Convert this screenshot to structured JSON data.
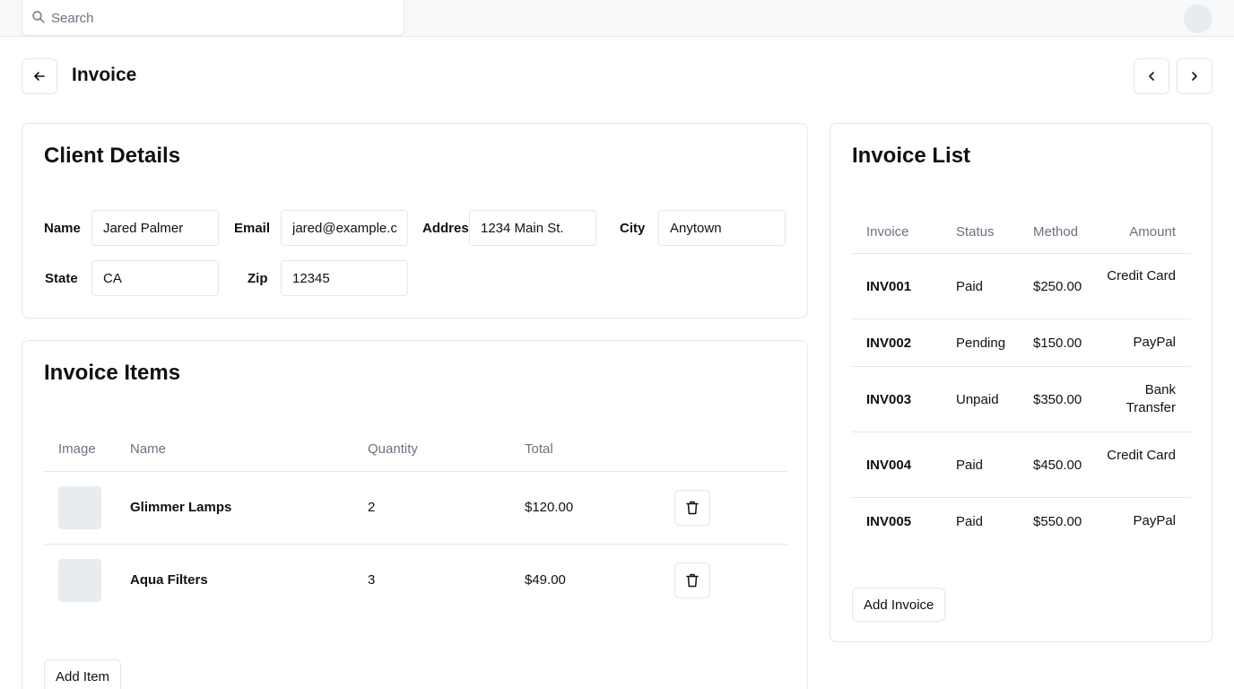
{
  "search": {
    "placeholder": "Search"
  },
  "header": {
    "title": "Invoice"
  },
  "client": {
    "title": "Client Details",
    "fields": {
      "name": {
        "label": "Name",
        "value": "Jared Palmer"
      },
      "email": {
        "label": "Email",
        "value": "jared@example.com"
      },
      "address": {
        "label": "Address",
        "value": "1234 Main St."
      },
      "city": {
        "label": "City",
        "value": "Anytown"
      },
      "state": {
        "label": "State",
        "value": "CA"
      },
      "zip": {
        "label": "Zip",
        "value": "12345"
      }
    }
  },
  "items": {
    "title": "Invoice Items",
    "columns": [
      "Image",
      "Name",
      "Quantity",
      "Total"
    ],
    "rows": [
      {
        "name": "Glimmer Lamps",
        "quantity": "2",
        "total": "$120.00"
      },
      {
        "name": "Aqua Filters",
        "quantity": "3",
        "total": "$49.00"
      }
    ],
    "add_label": "Add Item"
  },
  "invoice_list": {
    "title": "Invoice List",
    "columns": [
      "Invoice",
      "Status",
      "Method",
      "Amount"
    ],
    "rows": [
      {
        "invoice": "INV001",
        "status": "Paid",
        "method": "$250.00",
        "amount": "Credit Card"
      },
      {
        "invoice": "INV002",
        "status": "Pending",
        "method": "$150.00",
        "amount": "PayPal"
      },
      {
        "invoice": "INV003",
        "status": "Unpaid",
        "method": "$350.00",
        "amount": "Bank Transfer"
      },
      {
        "invoice": "INV004",
        "status": "Paid",
        "method": "$450.00",
        "amount": "Credit Card"
      },
      {
        "invoice": "INV005",
        "status": "Paid",
        "method": "$550.00",
        "amount": "PayPal"
      }
    ],
    "add_label": "Add Invoice"
  },
  "icons": {
    "search": "search-icon",
    "back": "arrow-left-icon",
    "prev": "chevron-left-icon",
    "next": "chevron-right-icon",
    "delete": "trash-icon"
  },
  "colors": {
    "border": "#e5e7eb",
    "muted_text": "#6b7280",
    "topbar_bg": "#f8f9fa",
    "placeholder_bg": "#e9ecef"
  }
}
